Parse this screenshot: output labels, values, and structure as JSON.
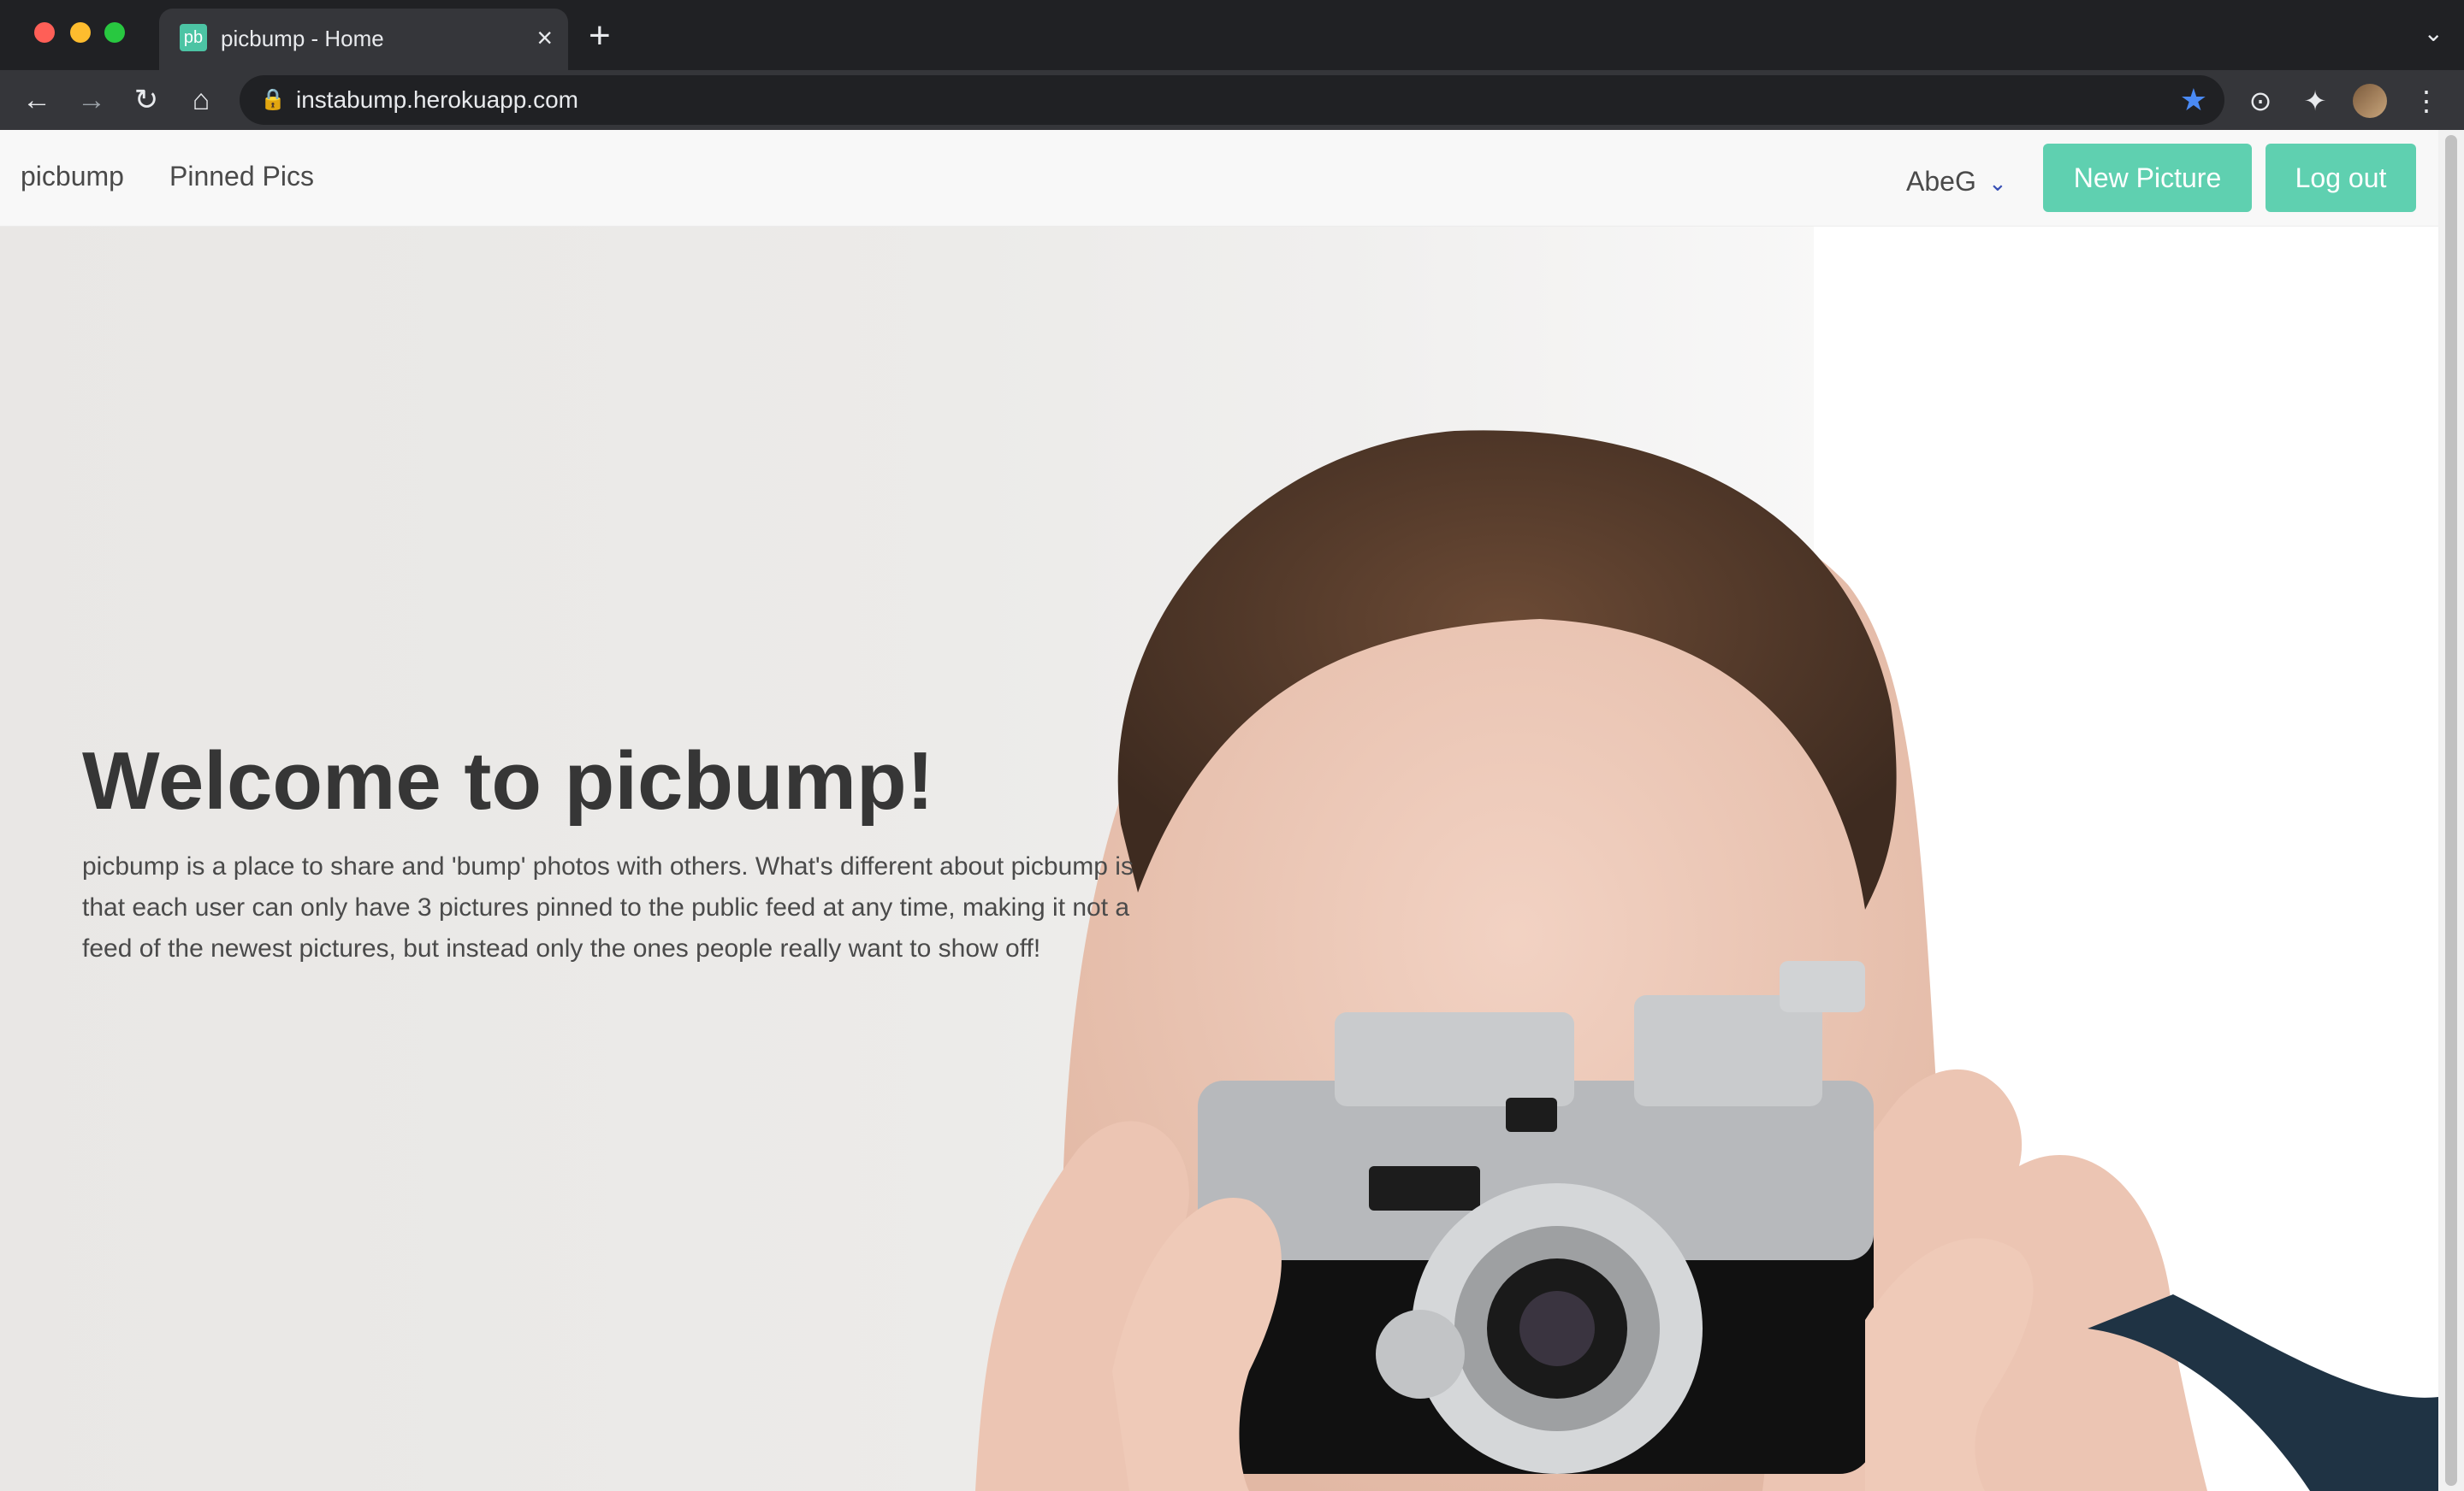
{
  "browser": {
    "tab": {
      "favicon": "pb",
      "title": "picbump - Home",
      "close": "×"
    },
    "new_tab": "+",
    "tab_search": "⌄",
    "back": "←",
    "forward": "→",
    "reload": "↻",
    "home": "⌂",
    "url": "instabump.herokuapp.com",
    "lock": "🔒",
    "bookmark_star": "★",
    "ext_icon": "⊙",
    "puzzle": "✦",
    "menu": "⋮"
  },
  "navbar": {
    "brand": "picbump",
    "pinned": "Pinned Pics",
    "user": "AbeG",
    "user_chevron": "⌄",
    "new_picture": "New Picture",
    "logout": "Log out"
  },
  "hero": {
    "title": "Welcome to picbump!",
    "text": "picbump is a place to share and 'bump' photos with others. What's different about picbump is that each user can only have 3 pictures pinned to the public feed at any time, making it not a feed of the newest pictures, but instead only the ones people really want to show off!"
  },
  "colors": {
    "accent": "#5fd0b0",
    "chevron": "#3850b5",
    "star": "#4a8af4"
  }
}
